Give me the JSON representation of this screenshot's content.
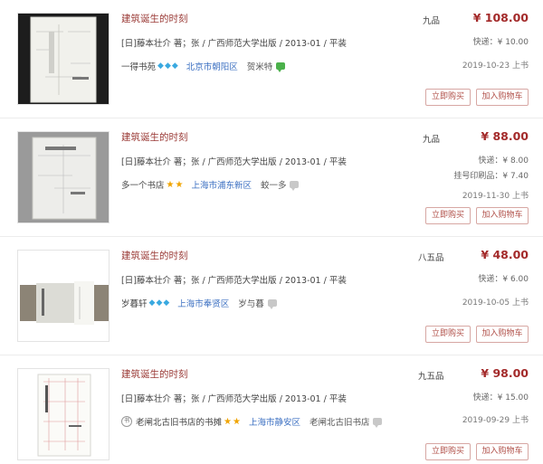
{
  "actions": {
    "buy_label": "立即购买",
    "cart_label": "加入购物车"
  },
  "listings": [
    {
      "title": "建筑诞生的时刻",
      "meta": "[日]藤本壮介 著；张 / 广西师范大学出版 / 2013-01 / 平装",
      "shop": "一得书苑",
      "badge_count": 3,
      "location": "北京市朝阳区",
      "customer_service": "贺米特",
      "condition": "九品",
      "price": "¥ 108.00",
      "shipping": "快递：¥ 10.00",
      "date": "2019-10-23 上书"
    },
    {
      "title": "建筑诞生的时刻",
      "meta": "[日]藤本壮介 著；张 / 广西师范大学出版 / 2013-01 / 平装",
      "shop": "多一个书店",
      "star_count": 2,
      "location": "上海市浦东新区",
      "customer_service": "蛟一多",
      "condition": "九品",
      "price": "¥ 88.00",
      "shipping": "快递：¥ 8.00",
      "shipping_registered": "挂号印刷品：¥ 7.40",
      "date": "2019-11-30 上书"
    },
    {
      "title": "建筑诞生的时刻",
      "meta": "[日]藤本壮介 著；张 / 广西师范大学出版 / 2013-01 / 平装",
      "shop": "岁暮轩",
      "badge_count": 3,
      "location": "上海市奉贤区",
      "customer_service": "岁与暮",
      "condition": "八五品",
      "price": "¥ 48.00",
      "shipping": "快递：¥ 6.00",
      "date": "2019-10-05 上书"
    },
    {
      "title": "建筑诞生的时刻",
      "meta": "[日]藤本壮介 著；张 / 广西师范大学出版 / 2013-01 / 平装",
      "shop": "老闸北古旧书店的书摊",
      "star_count": 2,
      "location": "上海市静安区",
      "customer_service": "老闸北古旧书店",
      "condition": "九五品",
      "price": "¥ 98.00",
      "shipping": "快递：¥ 15.00",
      "date": "2019-09-29 上书"
    }
  ]
}
